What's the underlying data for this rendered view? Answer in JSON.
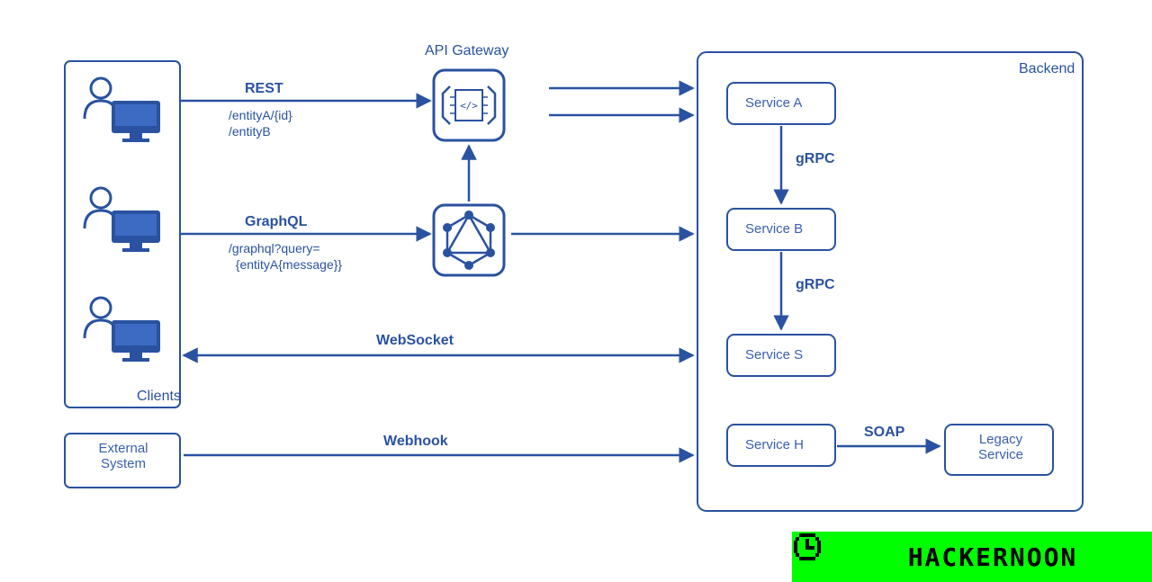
{
  "colors": {
    "stroke": "#2a52a0",
    "fill": "#ffffff",
    "fill_solid": "#2a52a0",
    "text": "#2a52a0",
    "watermark_bg": "#00ff00",
    "watermark_text": "#000000"
  },
  "clients": {
    "label": "Clients",
    "count": 3
  },
  "external_system": {
    "label": "External\nSystem"
  },
  "api_gateway": {
    "title": "API Gateway"
  },
  "graphql_icon": {
    "name": "graphql-icon"
  },
  "protocols": {
    "rest": {
      "label": "REST",
      "paths": [
        "/entityA/{id}",
        "/entityB"
      ]
    },
    "graphql": {
      "label": "GraphQL",
      "paths": [
        "/graphql?query=",
        "  {entityA{message}}"
      ]
    },
    "websocket": {
      "label": "WebSocket"
    },
    "webhook": {
      "label": "Webhook"
    },
    "grpc1": {
      "label": "gRPC"
    },
    "grpc2": {
      "label": "gRPC"
    },
    "soap": {
      "label": "SOAP"
    }
  },
  "backend": {
    "label": "Backend",
    "services": {
      "a": "Service A",
      "b": "Service B",
      "s": "Service S",
      "h": "Service H",
      "legacy": "Legacy\nService"
    }
  },
  "watermark": {
    "text": "HACKERNOON"
  }
}
